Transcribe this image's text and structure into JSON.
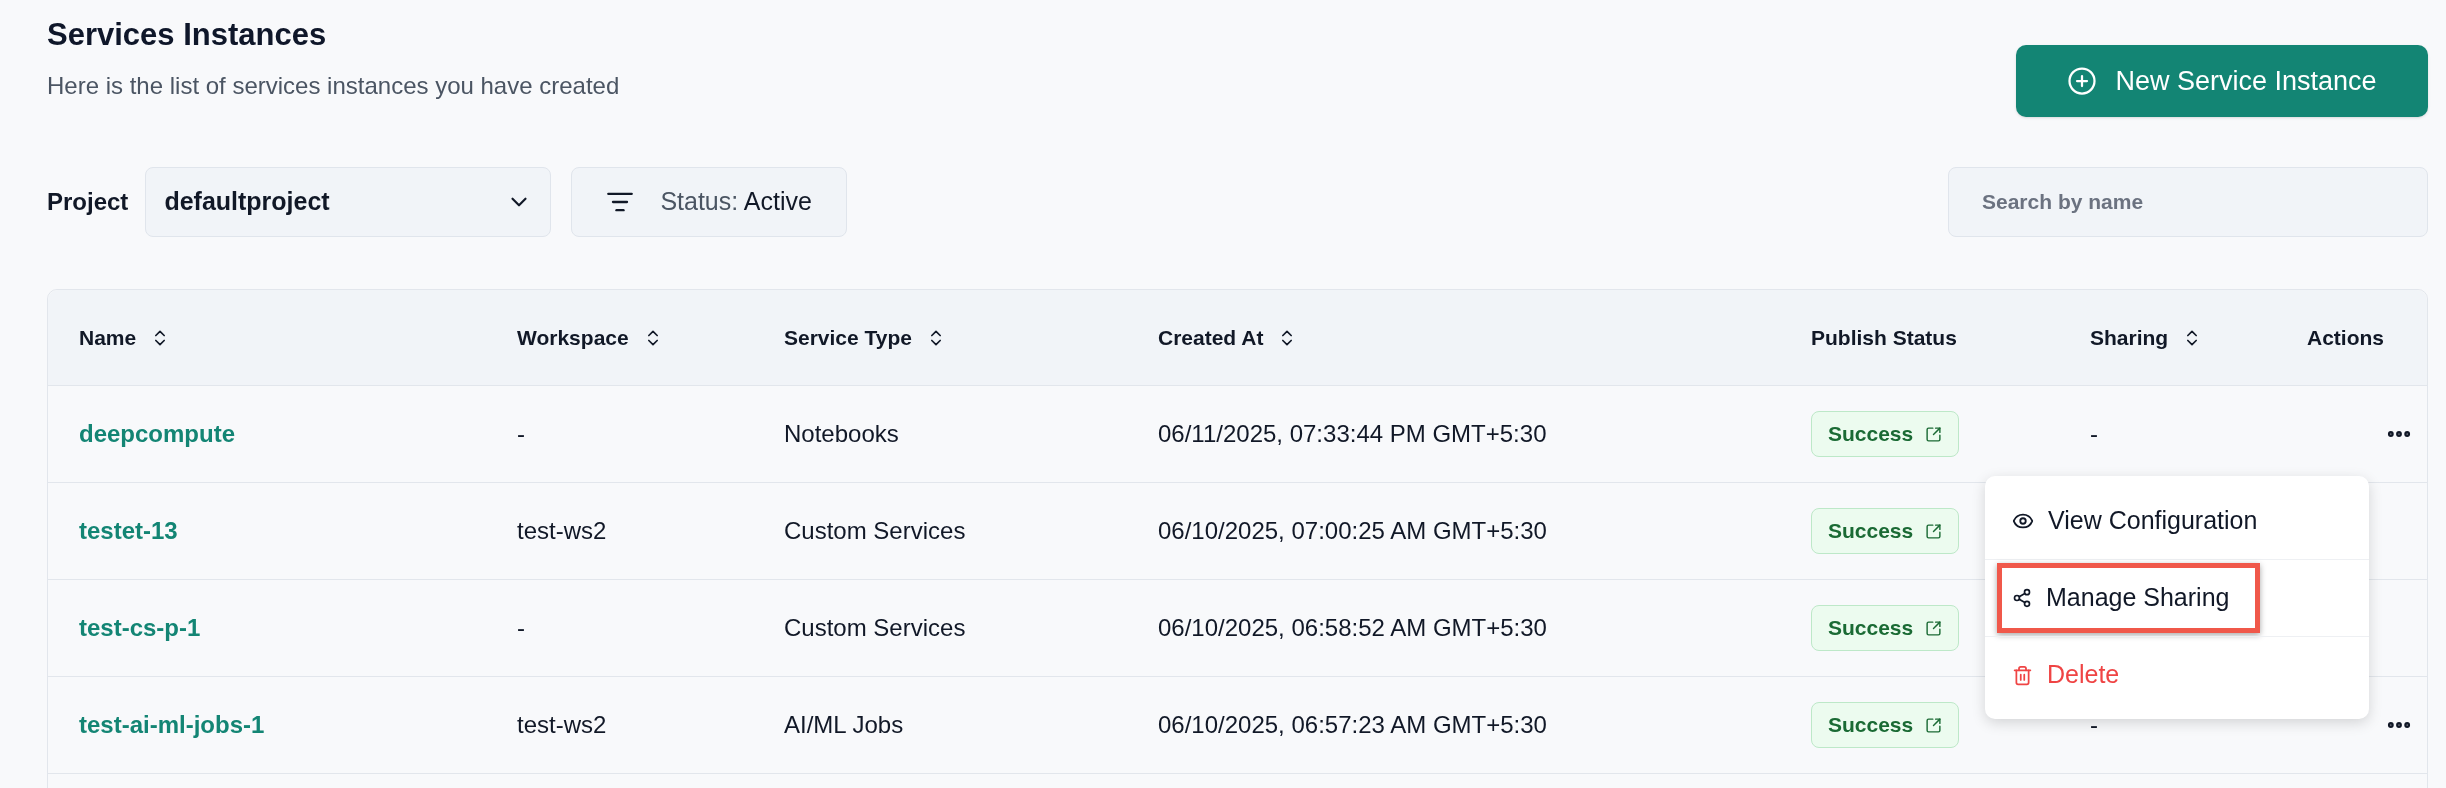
{
  "header": {
    "title": "Services Instances",
    "subtitle": "Here is the list of services instances you have created",
    "new_button": "New Service Instance"
  },
  "filters": {
    "project_label": "Project",
    "project_value": "defaultproject",
    "status_label": "Status:",
    "status_value": "Active",
    "search_placeholder": "Search by name"
  },
  "table": {
    "columns": [
      {
        "label": "Name",
        "sortable": true
      },
      {
        "label": "Workspace",
        "sortable": true
      },
      {
        "label": "Service Type",
        "sortable": true
      },
      {
        "label": "Created At",
        "sortable": true
      },
      {
        "label": "Publish Status",
        "sortable": false
      },
      {
        "label": "Sharing",
        "sortable": true
      },
      {
        "label": "Actions",
        "sortable": false
      }
    ],
    "rows": [
      {
        "name": "deepcompute",
        "workspace": "-",
        "service_type": "Notebooks",
        "created_at": "06/11/2025, 07:33:44 PM GMT+5:30",
        "publish_status": "Success",
        "sharing": "-",
        "actions_shown": true
      },
      {
        "name": "testet-13",
        "workspace": "test-ws2",
        "service_type": "Custom Services",
        "created_at": "06/10/2025, 07:00:25 AM GMT+5:30",
        "publish_status": "Success",
        "actions_shown": false
      },
      {
        "name": "test-cs-p-1",
        "workspace": "-",
        "service_type": "Custom Services",
        "created_at": "06/10/2025, 06:58:52 AM GMT+5:30",
        "publish_status": "Success",
        "actions_shown": false
      },
      {
        "name": "test-ai-ml-jobs-1",
        "workspace": "test-ws2",
        "service_type": "AI/ML Jobs",
        "created_at": "06/10/2025, 06:57:23 AM GMT+5:30",
        "publish_status": "Success",
        "sharing": "-",
        "actions_shown": true
      }
    ]
  },
  "action_menu": {
    "items": [
      {
        "label": "View Configuration",
        "kind": "view",
        "highlighted": false
      },
      {
        "label": "Manage Sharing",
        "kind": "share",
        "highlighted": true
      },
      {
        "label": "Delete",
        "kind": "delete",
        "highlighted": false
      }
    ]
  }
}
